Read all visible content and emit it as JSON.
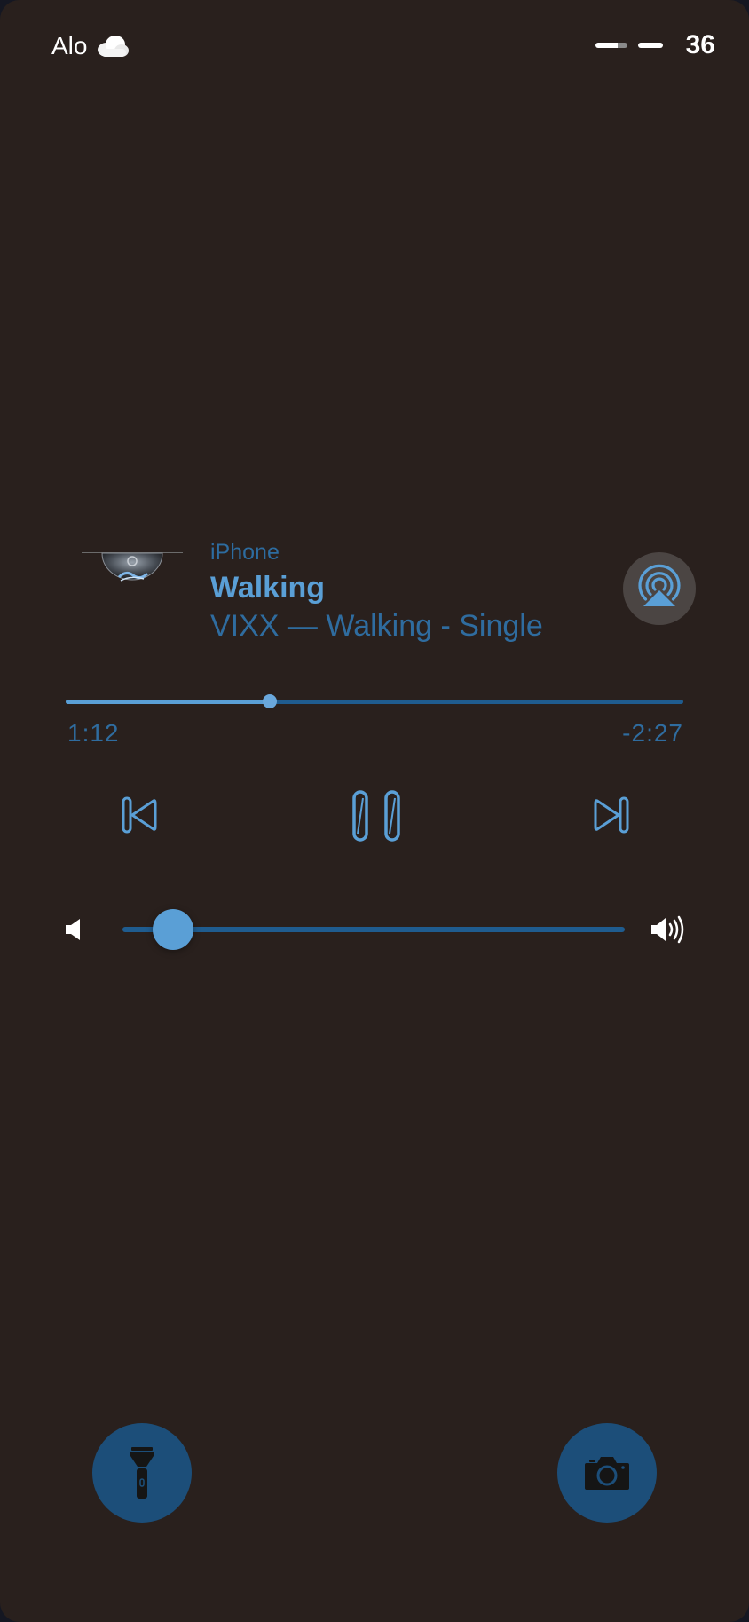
{
  "status_bar": {
    "carrier": "Alo",
    "weather_icon": "cloud-icon",
    "battery_percent": "36"
  },
  "now_playing": {
    "source": "iPhone",
    "title": "Walking",
    "subtitle": "VIXX — Walking - Single",
    "elapsed": "1:12",
    "remaining": "-2:27",
    "progress_fraction": 0.33,
    "volume_fraction": 0.1,
    "icons": {
      "airplay": "airplay-icon",
      "previous": "previous-track-icon",
      "pause": "pause-icon",
      "next": "next-track-icon",
      "volume_low": "volume-low-icon",
      "volume_high": "volume-high-icon"
    }
  },
  "quick_actions": {
    "flashlight": "flashlight-icon",
    "camera": "camera-icon"
  },
  "colors": {
    "background": "#29201d",
    "accent": "#5a9fd6",
    "accent_dark": "#2f6c9f",
    "track": "#1f5c8f",
    "button_bg": "#1c4e79"
  }
}
